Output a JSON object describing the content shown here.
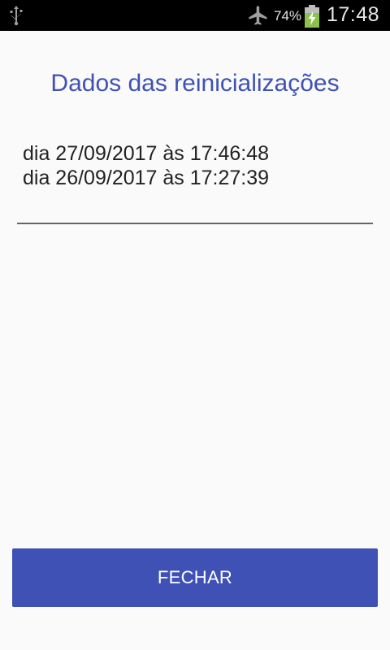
{
  "status_bar": {
    "battery_percent": "74%",
    "time": "17:48",
    "icons": [
      "usb-icon",
      "airplane-mode-icon",
      "battery-charging-icon"
    ],
    "battery_fill_color": "#8bc34a"
  },
  "dialog": {
    "title": "Dados das reinicializações",
    "entries": [
      "dia 27/09/2017 às 17:46:48",
      "dia 26/09/2017 às 17:27:39"
    ],
    "close_label": "FECHAR"
  },
  "colors": {
    "accent": "#3f51b5",
    "background": "#fafafa"
  }
}
